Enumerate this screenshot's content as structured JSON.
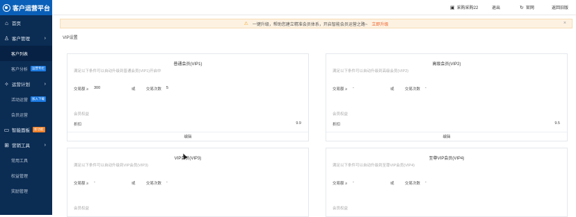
{
  "brand": {
    "name": "客户运营平台"
  },
  "sidebar": {
    "items": [
      {
        "icon": "home-icon",
        "label": "首页"
      },
      {
        "icon": "users-icon",
        "label": "客户管理"
      },
      {
        "label": "客户列表"
      },
      {
        "label": "客户分析",
        "tag": "运营专栏"
      },
      {
        "icon": "gear-icon",
        "label": "运营计划"
      },
      {
        "label": "活动运营",
        "tag": "加入下载"
      },
      {
        "label": "会员运营"
      },
      {
        "icon": "screen-icon",
        "label": "智能面板",
        "tag": "新功能"
      },
      {
        "icon": "apps-icon",
        "label": "营销工具"
      },
      {
        "label": "常用工具"
      },
      {
        "label": "权益管理"
      },
      {
        "label": "奖励管理"
      }
    ]
  },
  "topbar": {
    "user": "采购采购22",
    "logout": "退出",
    "help": "官网",
    "back": "返回旧版"
  },
  "notice": {
    "text": "一键升级，帮助您建立精准会员体系，开启智能会员运营之路~",
    "link": "立即升级",
    "close": "×"
  },
  "page": {
    "title": "VIP设置"
  },
  "cards": [
    {
      "title": "普通会员(VIP1)",
      "desc": "满足以下条件可以自动升级到普通会员(VIP1)开启中",
      "amount_label": "交易额 ≥",
      "amount_value": "300",
      "unit": "或",
      "count_label": "交易次数",
      "count_value": "5",
      "rights_label": "会员权益",
      "discount_label": "折扣",
      "discount_value": "9.9",
      "edit": "编辑"
    },
    {
      "title": "高级会员(VIP2)",
      "desc": "满足以下条件可以自动升级到高级会员(VIP2)",
      "amount_label": "交易额 ≥",
      "amount_value": "-",
      "unit": "或",
      "count_label": "交易次数",
      "count_value": "-",
      "rights_label": "会员权益",
      "discount_label": "折扣",
      "discount_value": "9.5",
      "edit": "编辑"
    },
    {
      "title": "VIP会员(VIP3)",
      "desc": "满足以下条件可以自动升级到VIP会员(VIP3)",
      "amount_label": "交易额 ≥",
      "amount_value": "-",
      "unit": "或",
      "count_label": "交易次数",
      "count_value": "-",
      "rights_label": "会员权益"
    },
    {
      "title": "至尊VIP会员(VIP4)",
      "desc": "满足以下条件可以自动升级到至尊VIP会员(VIP4)",
      "amount_label": "交易额 ≥",
      "amount_value": "-",
      "unit": "或",
      "count_label": "交易次数",
      "count_value": "-",
      "rights_label": "会员权益"
    }
  ]
}
